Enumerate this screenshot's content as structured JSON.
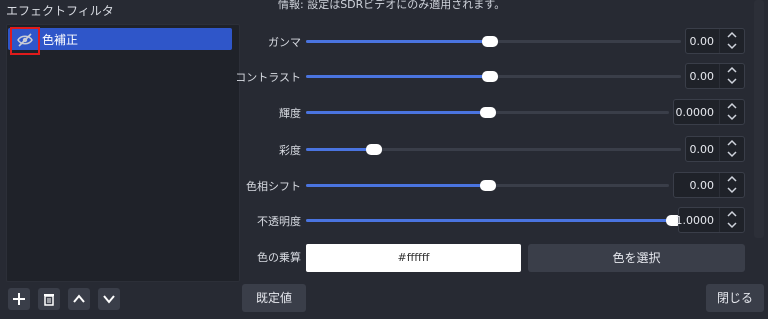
{
  "panel": {
    "title": "エフェクトフィルタ"
  },
  "filters": [
    {
      "label": "色補正",
      "visible": false,
      "selected": true
    }
  ],
  "info": {
    "note": "情報: 設定はSDRビデオにのみ適用されます。"
  },
  "controls": [
    {
      "label": "ガンマ",
      "value": "0.00",
      "level": 0.49
    },
    {
      "label": "コントラスト",
      "value": "0.00",
      "level": 0.49
    },
    {
      "label": "輝度",
      "value": "0.0000",
      "level": 0.5
    },
    {
      "label": "彩度",
      "value": "0.00",
      "level": 0.18
    },
    {
      "label": "色相シフト",
      "value": "0.00",
      "level": 0.5
    },
    {
      "label": "不透明度",
      "value": "1.0000",
      "level": 1.0
    }
  ],
  "color_multiply": {
    "label": "色の乗算",
    "hex": "#ffffff",
    "pick_label": "色を選択"
  },
  "footer": {
    "defaults_label": "既定値",
    "close_label": "閉じる"
  },
  "toolbar": {
    "add": "add-icon",
    "remove": "trash-icon",
    "up": "arrow-up-icon",
    "down": "arrow-down-icon"
  },
  "colors": {
    "accent": "#4a74e0",
    "selection": "#2f56c9",
    "highlight_border": "#e01b1b"
  }
}
